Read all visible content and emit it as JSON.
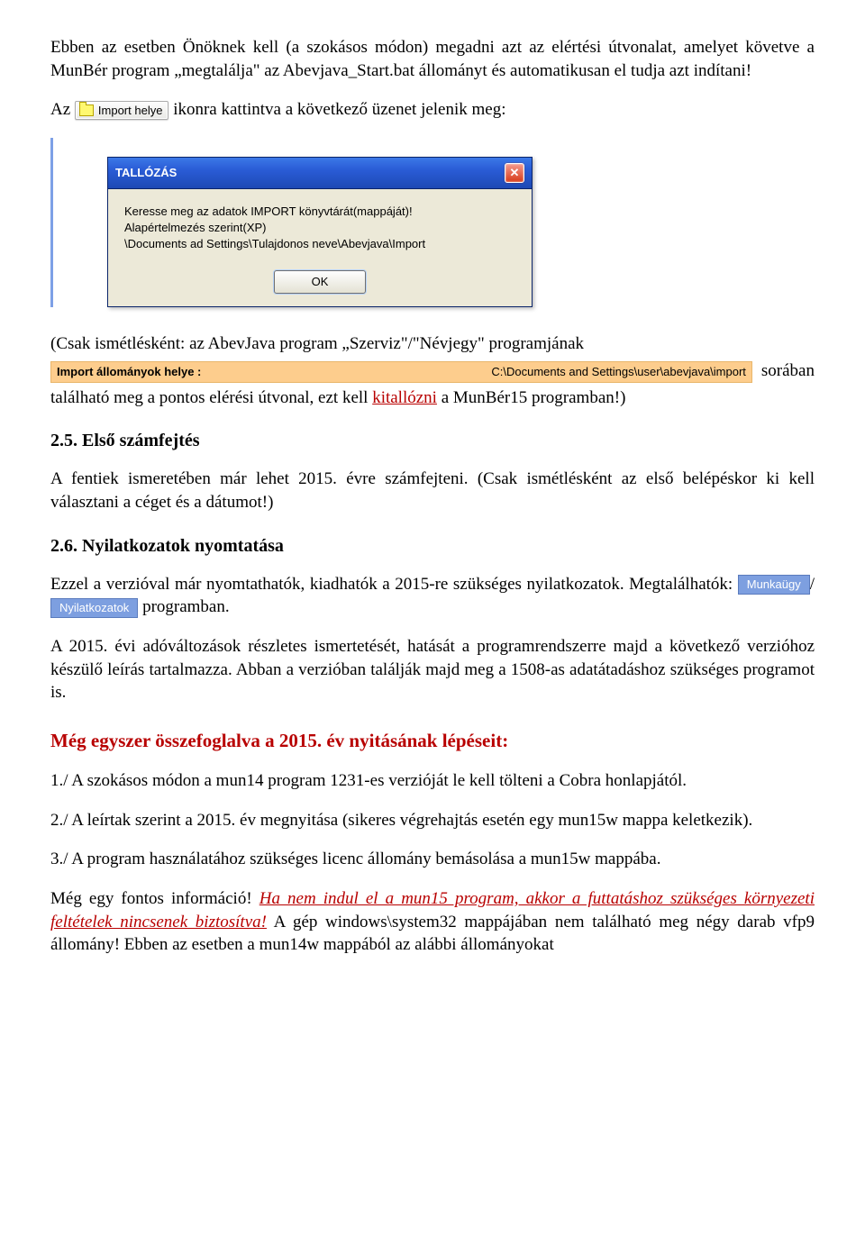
{
  "para1": "Ebben az esetben Önöknek kell (a szokásos módon) megadni azt az elértési útvonalat, amelyet követve a MunBér program „megtalálja\" az Abevjava_Start.bat állományt és automatikusan el tudja azt indítani!",
  "az_prefix": "Az",
  "import_button_label": "Import helye",
  "az_suffix": " ikonra kattintva  a következő üzenet jelenik meg:",
  "dialog": {
    "title": "TALLÓZÁS",
    "line1": "Keresse meg az adatok IMPORT könyvtárát(mappáját)!",
    "line2": "Alapértelmezés szerint(XP)",
    "line3": "\\Documents ad Settings\\Tulajdonos neve\\Abevjava\\Import",
    "ok": "OK"
  },
  "after_dialog_pre": "(Csak ismétlésként: az AbevJava program „Szerviz\"/\"Névjegy\" programjának",
  "orange": {
    "label": "Import állományok helye :",
    "path": "C:\\Documents and Settings\\user\\abevjava\\import"
  },
  "soraban": "sorában",
  "after_dialog_line2a": "található meg a pontos elérési útvonal, ezt kell ",
  "kitallozni": "kitallózni",
  "after_dialog_line2b": " a MunBér15 programban!)",
  "h25": "2.5. Első számfejtés",
  "p25": "A fentiek ismeretében már lehet 2015. évre számfejteni. (Csak ismétlésként az első belépéskor ki kell választani a céget és a dátumot!)",
  "h26": "2.6. Nyilatkozatok nyomtatása",
  "p26a": "Ezzel a verzióval már nyomtathatók, kiadhatók a 2015-re szükséges nyilatkozatok. Megtalálhatók: ",
  "chip_munka": "Munkaügy",
  "slash": "/",
  "chip_nyil": "Nyilatkozatok",
  "p26b": " programban.",
  "p26_2": "A 2015. évi adóváltozások részletes ismertetését, hatását a programrendszerre majd a következő verzióhoz készülő leírás tartalmazza. Abban a verzióban találják majd meg a 1508-as adatátadáshoz szükséges programot is.",
  "h_red": "Még egyszer összefoglalva a 2015. év nyitásának lépéseit:",
  "step1": "1./ A szokásos módon a mun14 program 1231-es verzióját le kell tölteni a Cobra honlapjától.",
  "step2": "2./ A leírtak szerint a 2015. év megnyitása (sikeres végrehajtás esetén egy mun15w mappa keletkezik).",
  "step3": "3./ A program használatához szükséges licenc állomány bemásolása a mun15w mappába.",
  "last_pre": "Még egy fontos információ! ",
  "last_red": "Ha nem indul el a mun15 program, akkor a futtatáshoz szükséges környezeti feltételek nincsenek biztosítva!",
  "last_post": " A gép windows\\system32 mappájában nem található meg négy darab vfp9 állomány! Ebben az esetben a mun14w mappából az alábbi állományokat"
}
